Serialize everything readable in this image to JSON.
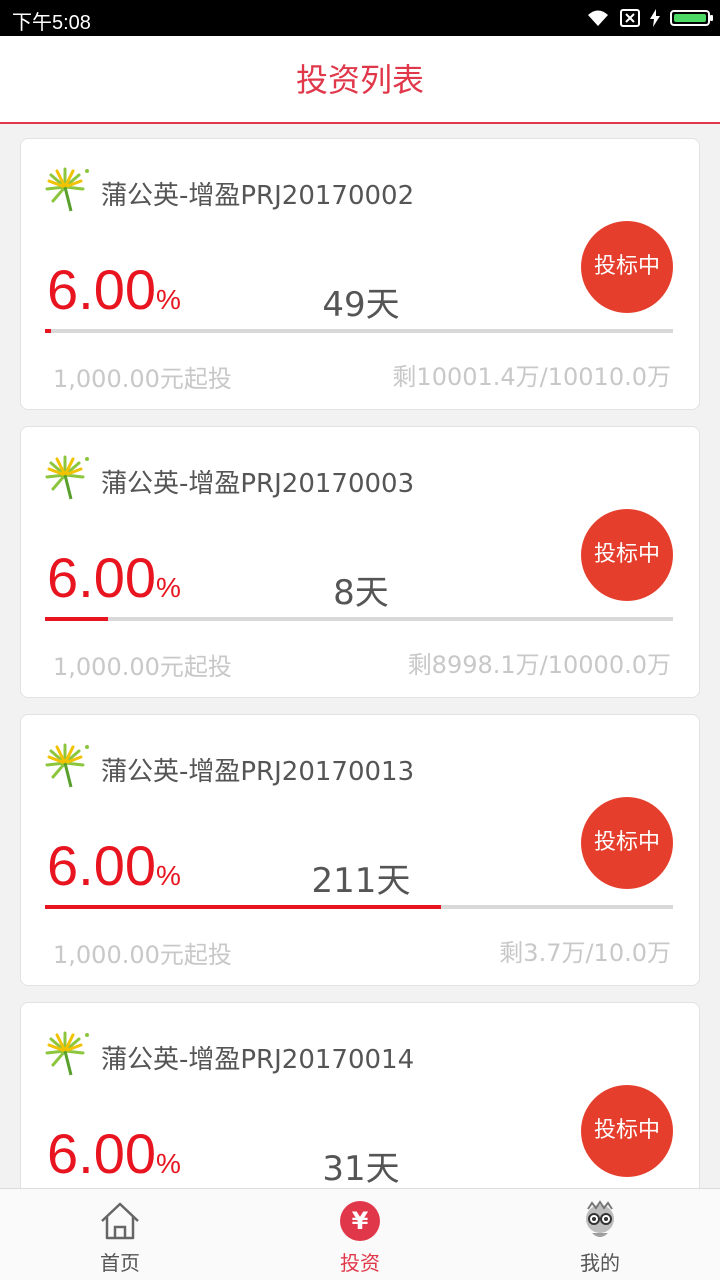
{
  "status_bar": {
    "time": "下午5:08"
  },
  "header": {
    "title": "投资列表"
  },
  "colors": {
    "accent": "#e0384a",
    "rate": "#e8141f",
    "button": "#e63e2c"
  },
  "products": [
    {
      "name": "蒲公英-增盈PRJ20170002",
      "rate": "6.00",
      "rate_unit": "%",
      "days": "49天",
      "status": "投标中",
      "progress": 0.01,
      "min_invest": "1,000.00元起投",
      "remaining": "剩10001.4万/10010.0万"
    },
    {
      "name": "蒲公英-增盈PRJ20170003",
      "rate": "6.00",
      "rate_unit": "%",
      "days": "8天",
      "status": "投标中",
      "progress": 0.1,
      "min_invest": "1,000.00元起投",
      "remaining": "剩8998.1万/10000.0万"
    },
    {
      "name": "蒲公英-增盈PRJ20170013",
      "rate": "6.00",
      "rate_unit": "%",
      "days": "211天",
      "status": "投标中",
      "progress": 0.63,
      "min_invest": "1,000.00元起投",
      "remaining": "剩3.7万/10.0万"
    },
    {
      "name": "蒲公英-增盈PRJ20170014",
      "rate": "6.00",
      "rate_unit": "%",
      "days": "31天",
      "status": "投标中",
      "progress": 0.0,
      "min_invest": "",
      "remaining": ""
    }
  ],
  "tabbar": {
    "items": [
      {
        "label": "首页",
        "icon": "home-icon"
      },
      {
        "label": "投资",
        "icon": "yen-icon",
        "symbol": "¥"
      },
      {
        "label": "我的",
        "icon": "avatar-icon"
      }
    ]
  }
}
